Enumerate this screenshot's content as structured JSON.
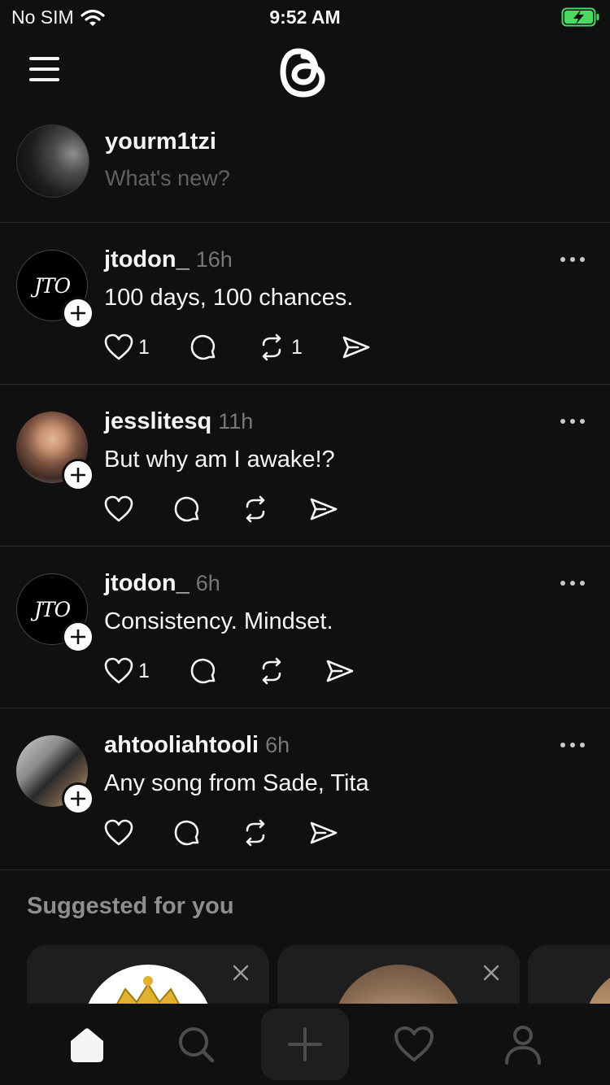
{
  "status_bar": {
    "carrier": "No SIM",
    "time": "9:52 AM",
    "battery_color": "#4cd964"
  },
  "composer": {
    "username": "yourm1tzi",
    "placeholder": "What's new?"
  },
  "posts": [
    {
      "username": "jtodon_",
      "time": "16h",
      "text": "100 days, 100 chances.",
      "likes": "1",
      "reposts": "1",
      "avatar_text": "JTO"
    },
    {
      "username": "jesslitesq",
      "time": "11h",
      "text": "But why am I awake!?",
      "likes": "",
      "reposts": ""
    },
    {
      "username": "jtodon_",
      "time": "6h",
      "text": "Consistency. Mindset.",
      "likes": "1",
      "reposts": "",
      "avatar_text": "JTO"
    },
    {
      "username": "ahtooliahtooli",
      "time": "6h",
      "text": "Any song from Sade, Tita",
      "likes": "",
      "reposts": ""
    }
  ],
  "suggested": {
    "title": "Suggested for you"
  },
  "tabbar": {
    "items": [
      "home-icon",
      "search-icon",
      "plus-icon",
      "heart-icon",
      "person-icon"
    ],
    "active": "home-icon"
  }
}
